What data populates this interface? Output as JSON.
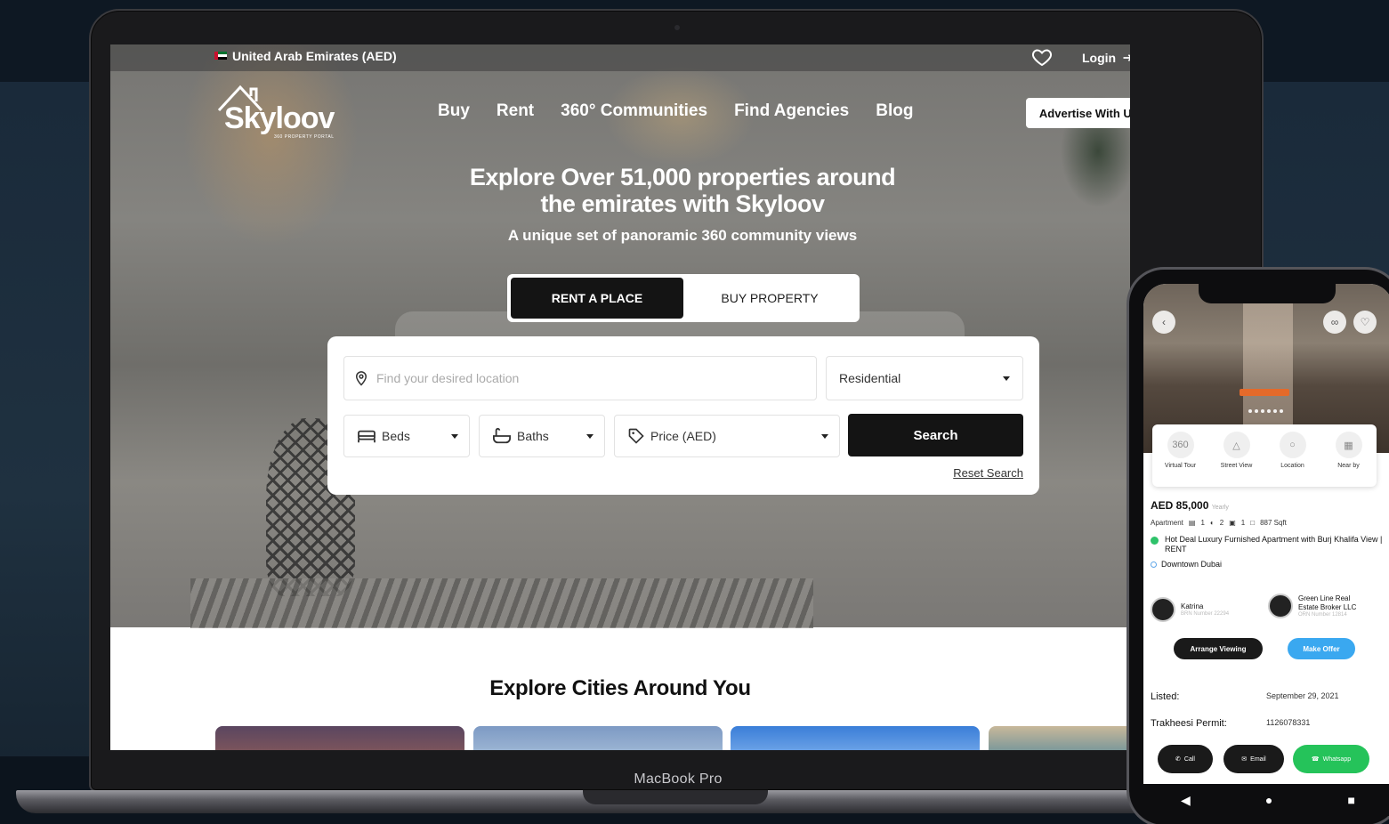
{
  "laptop": {
    "brand": "MacBook Pro"
  },
  "topbar": {
    "region": "United Arab Emirates (AED)",
    "login": "Login"
  },
  "logo": {
    "text": "Skyloov",
    "tagline": "360 PROPERTY PORTAL"
  },
  "nav": {
    "items": [
      "Buy",
      "Rent",
      "360° Communities",
      "Find Agencies",
      "Blog"
    ],
    "advertise": "Advertise With Us"
  },
  "hero": {
    "title_line1": "Explore Over 51,000 properties around",
    "title_line2": "the emirates with Skyloov",
    "subtitle": "A unique set of panoramic 360 community views"
  },
  "tabs": {
    "rent": "RENT A PLACE",
    "buy": "BUY PROPERTY",
    "active": "rent"
  },
  "search": {
    "location_placeholder": "Find your desired location",
    "type_value": "Residential",
    "beds_label": "Beds",
    "baths_label": "Baths",
    "price_label": "Price (AED)",
    "search_button": "Search",
    "reset_link": "Reset Search"
  },
  "section": {
    "title": "Explore Cities Around You"
  },
  "phone": {
    "icons": [
      {
        "label": "Virtual Tour",
        "icon": "360-icon"
      },
      {
        "label": "Street View",
        "icon": "street-view-icon"
      },
      {
        "label": "Location",
        "icon": "location-pin-icon"
      },
      {
        "label": "Near by",
        "icon": "nearby-icon"
      }
    ],
    "price": "AED 85,000",
    "price_period": "Yearly",
    "property_type": "Apartment",
    "beds": "1",
    "baths": "2",
    "parking": "1",
    "area": "887 Sqft",
    "title": "Hot Deal Luxury Furnished Apartment with Burj Khalifa View | RENT",
    "location": "Downtown Dubai",
    "agent_name": "Katrina",
    "agent_sub": "BRN Number 22294",
    "agency_name_1": "Green Line Real",
    "agency_name_2": "Estate Broker LLC",
    "agency_sub": "ORN Number 12814",
    "arrange_viewing": "Arrange Viewing",
    "make_offer": "Make Offer",
    "listed_label": "Listed:",
    "listed_value": "September 29, 2021",
    "permit_label": "Trakheesi Permit:",
    "permit_value": "1126078331",
    "call": "Call",
    "email": "Email",
    "whatsapp": "Whatsapp"
  },
  "colors": {
    "primary_dark": "#141414",
    "accent_blue": "#3aa8f0",
    "whatsapp_green": "#25c35a"
  }
}
